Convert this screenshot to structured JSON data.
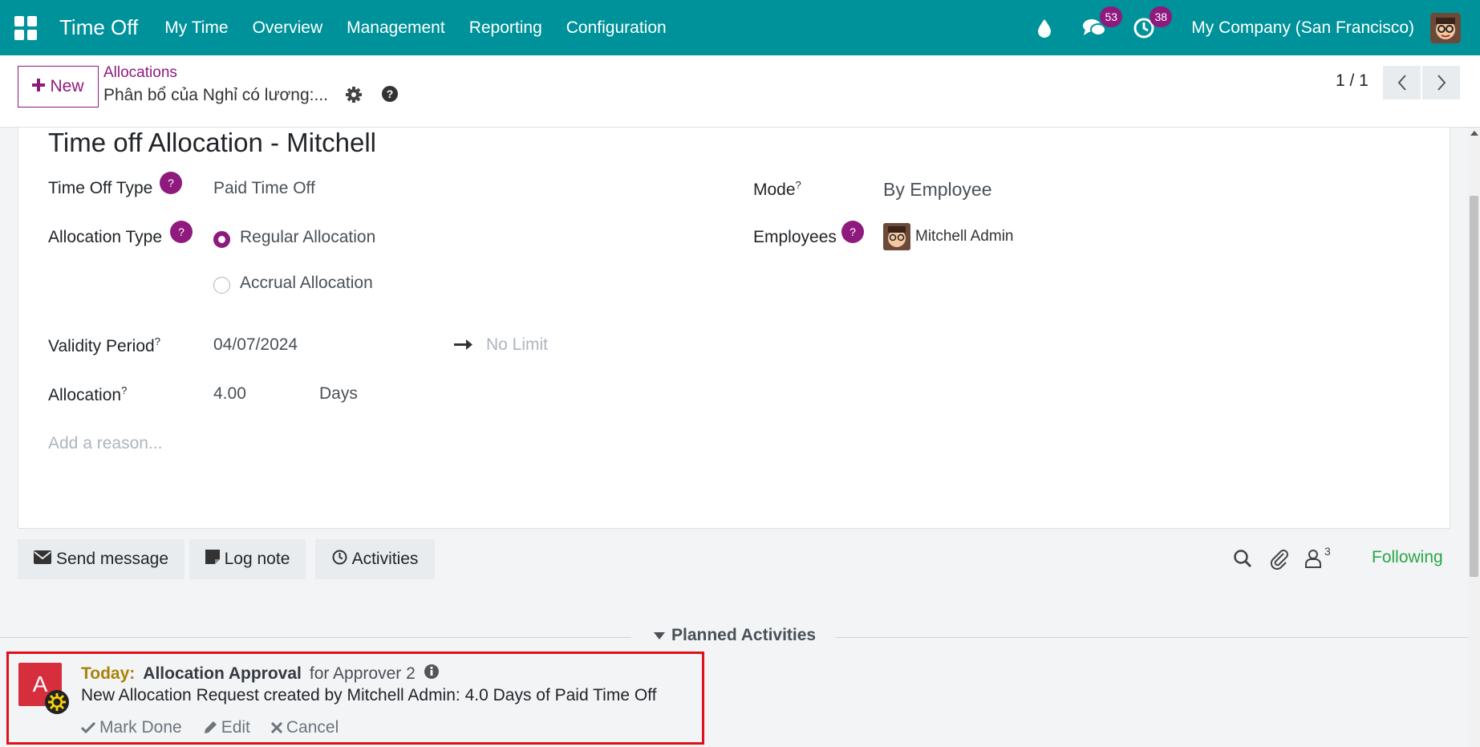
{
  "navbar": {
    "brand": "Time Off",
    "menu": [
      "My Time",
      "Overview",
      "Management",
      "Reporting",
      "Configuration"
    ],
    "messages_count": "53",
    "activities_count": "38",
    "company": "My Company (San Francisco)"
  },
  "control": {
    "new_label": "New",
    "breadcrumb_parent": "Allocations",
    "breadcrumb_current": "Phân bổ của Nghỉ có lương:...",
    "pager": "1 / 1"
  },
  "form": {
    "title": "Time off Allocation - Mitchell",
    "time_off_type_label": "Time Off Type",
    "time_off_type_value": "Paid Time Off",
    "allocation_type_label": "Allocation Type",
    "allocation_type_options": [
      "Regular Allocation",
      "Accrual Allocation"
    ],
    "allocation_type_selected": "Regular Allocation",
    "validity_label": "Validity Period",
    "validity_start": "04/07/2024",
    "validity_end_placeholder": "No Limit",
    "allocation_label": "Allocation",
    "allocation_value": "4.00",
    "allocation_unit": "Days",
    "reason_placeholder": "Add a reason...",
    "mode_label": "Mode",
    "mode_value": "By Employee",
    "employees_label": "Employees",
    "employee_name": "Mitchell Admin",
    "help_mark": "?",
    "tooltip_mark": "?"
  },
  "chatter": {
    "send_message": "Send message",
    "log_note": "Log note",
    "activities": "Activities",
    "followers_count": "3",
    "following": "Following"
  },
  "planned": {
    "header": "Planned Activities",
    "avatar_letter": "A",
    "when": "Today:",
    "type": "Allocation Approval",
    "for": "for Approver 2",
    "note": "New Allocation Request created by Mitchell Admin: 4.0 Days of Paid Time Off",
    "mark_done": "Mark Done",
    "edit": "Edit",
    "cancel": "Cancel"
  },
  "colors": {
    "navbar": "#00929a",
    "brand_purple": "#8f1a7e",
    "following_green": "#28a745",
    "highlight_red": "#e0101a"
  }
}
